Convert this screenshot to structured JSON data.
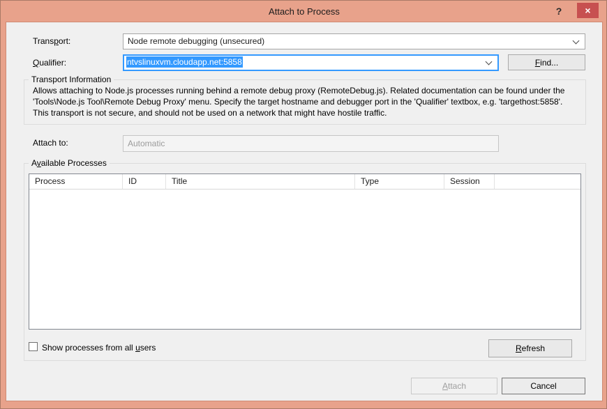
{
  "window": {
    "title": "Attach to Process",
    "help_glyph": "?",
    "close_glyph": "×"
  },
  "colors": {
    "titlebar": "#e8a28b",
    "close_button": "#c75050",
    "dialog_bg": "#f0f0f0",
    "focus_border": "#3399ff",
    "selection_bg": "#3399ff"
  },
  "transport": {
    "label": {
      "pre": "Trans",
      "mnemonic": "p",
      "post": "ort:"
    },
    "value": "Node remote debugging (unsecured)"
  },
  "qualifier": {
    "label": {
      "pre": "",
      "mnemonic": "Q",
      "post": "ualifier:"
    },
    "value": "ntvslinuxvm.cloudapp.net:5858",
    "find_button": {
      "mnemonic": "F",
      "post": "ind..."
    }
  },
  "transport_information": {
    "title": "Transport Information",
    "lines": [
      "Allows attaching to Node.js processes running behind a remote debug proxy (RemoteDebug.js). Related documentation can be found under the",
      "'Tools\\Node.js Tool\\Remote Debug Proxy' menu. Specify the target hostname and debugger port in the 'Qualifier' textbox, e.g. 'targethost:5858'.",
      "This transport is not secure, and should not be used on a network that might have hostile traffic."
    ]
  },
  "attach_to": {
    "label": "Attach to:",
    "value": "Automatic"
  },
  "available_processes": {
    "title": {
      "pre": "A",
      "mnemonic": "v",
      "post": "ailable Processes"
    },
    "columns": [
      "Process",
      "ID",
      "Title",
      "Type",
      "Session",
      ""
    ],
    "rows": []
  },
  "footer": {
    "show_all_users": {
      "pre": "Show processes from all ",
      "mnemonic": "u",
      "post": "sers",
      "checked": false
    },
    "refresh_button": {
      "mnemonic": "R",
      "post": "efresh"
    },
    "attach_button": {
      "mnemonic": "A",
      "post": "ttach",
      "enabled": false
    },
    "cancel_button": {
      "label": "Cancel"
    }
  }
}
